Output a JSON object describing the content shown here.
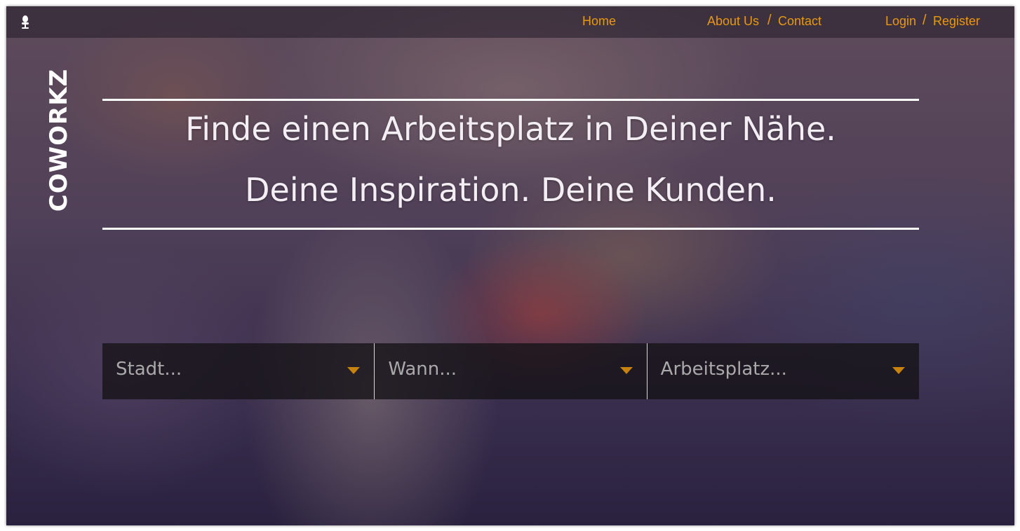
{
  "nav": {
    "home": "Home",
    "about": "About Us",
    "contact": "Contact",
    "login": "Login",
    "register": "Register",
    "separator": "/"
  },
  "brand": {
    "name": "COWORKZ",
    "icon": "chair-icon"
  },
  "hero": {
    "line1": "Finde einen Arbeitsplatz in Deiner Nähe.",
    "line2": "Deine Inspiration. Deine Kunden."
  },
  "search": {
    "city_placeholder": "Stadt...",
    "when_placeholder": "Wann...",
    "workspace_placeholder": "Arbeitsplatz..."
  },
  "colors": {
    "accent": "#e8990f",
    "caret": "#c8820e",
    "headline": "#f3eef3"
  }
}
